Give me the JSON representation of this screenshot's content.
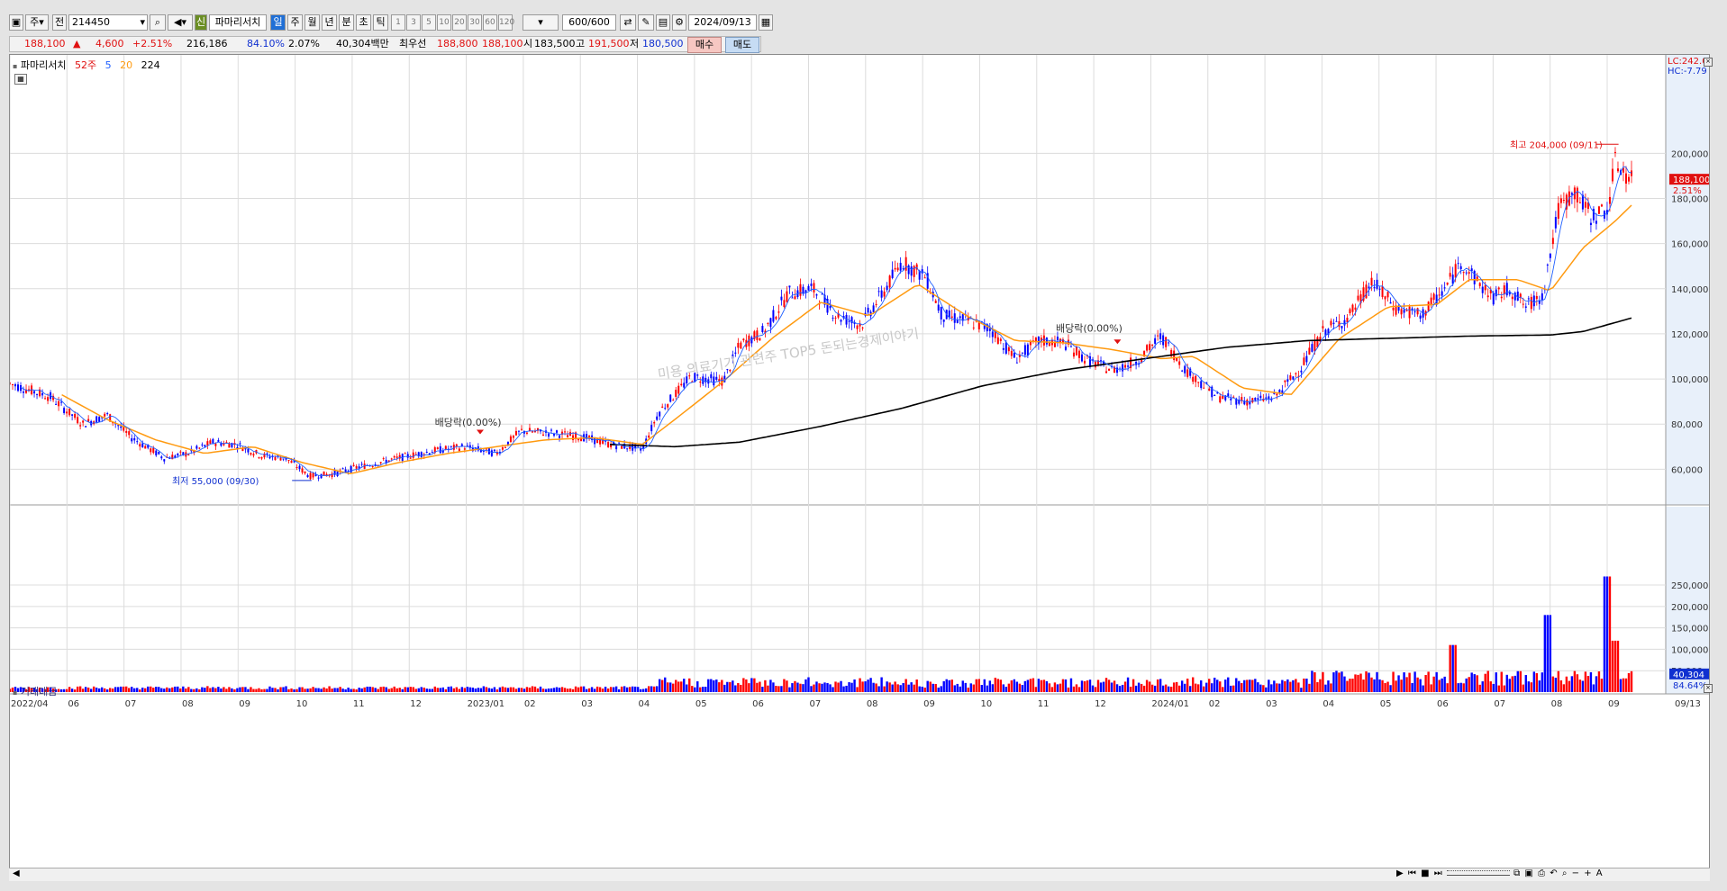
{
  "toolbar": {
    "market_select": "주",
    "scope_label": "전",
    "code": "214450",
    "new_badge": "신",
    "stock_name": "파마리서치",
    "periods": [
      "일",
      "주",
      "월",
      "년",
      "분",
      "초",
      "틱"
    ],
    "active_period": "일",
    "intervals": [
      "1",
      "3",
      "5",
      "10",
      "20",
      "30",
      "60",
      "120"
    ],
    "count": "600",
    "count_total": "/600",
    "date": "2024/09/13"
  },
  "quote": {
    "price": "188,100",
    "arrow": "▲",
    "change": "4,600",
    "change_pct": "+2.51%",
    "volume": "216,186",
    "ratio1": "84.10%",
    "ratio2": "2.07%",
    "amount": "40,304백만",
    "best_label": "최우선",
    "ask": "188,800",
    "bid": "188,100",
    "open_label": "시",
    "open": "183,500",
    "high_label": "고",
    "high": "191,500",
    "low_label": "저",
    "low": "180,500",
    "buy_label": "매수",
    "sell_label": "매도"
  },
  "legend": {
    "name": "파마리서치",
    "ma_52": "52주",
    "ma_5": "5",
    "ma_20": "20",
    "ma_224": "224"
  },
  "volume_panel": {
    "title": "거래대금"
  },
  "annotations": {
    "high": "최고 204,000 (09/11)",
    "low": "최저 55,000 (09/30)",
    "ex_div1": "배당락(0.00%)",
    "ex_div2": "배당락(0.00%)",
    "watermark": "미용 의료기기 관련주 TOP5 돈되는경제이야기"
  },
  "right_axis": {
    "lc": "LC:242.00",
    "hc": "HC:-7.79",
    "price_tag": "188,100",
    "pct_tag": "2.51%",
    "vol_tag": "40,304",
    "vol_pct": "84.64%",
    "date_tag": "09/13"
  },
  "colors": {
    "up": "#ff0000",
    "down": "#0000ff",
    "ma5": "#2060ff",
    "ma20": "#ff9a10",
    "ma224": "#000000",
    "grid": "#dcdcdc"
  },
  "chart_data": {
    "type": "candlestick",
    "ylim": [
      45000,
      242000
    ],
    "price_ticks": [
      "200,000",
      "180,000",
      "160,000",
      "140,000",
      "120,000",
      "100,000",
      "80,000",
      "60,000"
    ],
    "price_tick_values": [
      200000,
      180000,
      160000,
      140000,
      120000,
      100000,
      80000,
      60000
    ],
    "volume_ticks": [
      "250,000",
      "200,000",
      "150,000",
      "100,000",
      "50,000"
    ],
    "volume_tick_values": [
      250000,
      200000,
      150000,
      100000,
      50000
    ],
    "volume_ylim": [
      0,
      290000
    ],
    "x_labels": [
      "2022/04",
      "06",
      "07",
      "08",
      "09",
      "10",
      "11",
      "12",
      "2023/01",
      "02",
      "03",
      "04",
      "05",
      "06",
      "07",
      "08",
      "09",
      "10",
      "11",
      "12",
      "2024/01",
      "02",
      "03",
      "04",
      "05",
      "06",
      "07",
      "08",
      "09"
    ],
    "price_path": [
      [
        0,
        98000
      ],
      [
        0.025,
        92000
      ],
      [
        0.045,
        80000
      ],
      [
        0.06,
        84000
      ],
      [
        0.075,
        74000
      ],
      [
        0.095,
        65000
      ],
      [
        0.11,
        67000
      ],
      [
        0.125,
        72000
      ],
      [
        0.14,
        71000
      ],
      [
        0.155,
        66000
      ],
      [
        0.17,
        65000
      ],
      [
        0.185,
        57000
      ],
      [
        0.2,
        58000
      ],
      [
        0.215,
        61000
      ],
      [
        0.24,
        65000
      ],
      [
        0.26,
        68000
      ],
      [
        0.28,
        70000
      ],
      [
        0.3,
        67000
      ],
      [
        0.315,
        77000
      ],
      [
        0.335,
        76000
      ],
      [
        0.355,
        74000
      ],
      [
        0.37,
        71000
      ],
      [
        0.39,
        69000
      ],
      [
        0.4,
        85000
      ],
      [
        0.42,
        101000
      ],
      [
        0.44,
        99000
      ],
      [
        0.45,
        115000
      ],
      [
        0.465,
        121000
      ],
      [
        0.48,
        138000
      ],
      [
        0.495,
        140000
      ],
      [
        0.51,
        128000
      ],
      [
        0.525,
        124000
      ],
      [
        0.54,
        140000
      ],
      [
        0.55,
        152000
      ],
      [
        0.565,
        145000
      ],
      [
        0.575,
        128000
      ],
      [
        0.59,
        126000
      ],
      [
        0.605,
        122000
      ],
      [
        0.62,
        109000
      ],
      [
        0.635,
        117000
      ],
      [
        0.65,
        116000
      ],
      [
        0.665,
        108000
      ],
      [
        0.68,
        104000
      ],
      [
        0.695,
        108000
      ],
      [
        0.71,
        119000
      ],
      [
        0.725,
        104000
      ],
      [
        0.745,
        92000
      ],
      [
        0.765,
        90000
      ],
      [
        0.78,
        92000
      ],
      [
        0.795,
        104000
      ],
      [
        0.81,
        121000
      ],
      [
        0.825,
        127000
      ],
      [
        0.84,
        143000
      ],
      [
        0.855,
        131000
      ],
      [
        0.87,
        128000
      ],
      [
        0.885,
        140000
      ],
      [
        0.895,
        152000
      ],
      [
        0.905,
        143000
      ],
      [
        0.915,
        136000
      ],
      [
        0.925,
        140000
      ],
      [
        0.935,
        132000
      ],
      [
        0.945,
        137000
      ],
      [
        0.955,
        175000
      ],
      [
        0.965,
        183000
      ],
      [
        0.975,
        172000
      ],
      [
        0.985,
        175000
      ],
      [
        0.99,
        196000
      ],
      [
        1.0,
        188100
      ]
    ],
    "ma20_path": [
      [
        0.032,
        93000
      ],
      [
        0.06,
        82000
      ],
      [
        0.09,
        73000
      ],
      [
        0.12,
        67000
      ],
      [
        0.15,
        70000
      ],
      [
        0.18,
        63000
      ],
      [
        0.21,
        58000
      ],
      [
        0.24,
        63000
      ],
      [
        0.27,
        67000
      ],
      [
        0.3,
        70000
      ],
      [
        0.33,
        73000
      ],
      [
        0.36,
        74000
      ],
      [
        0.39,
        71000
      ],
      [
        0.41,
        82000
      ],
      [
        0.44,
        99000
      ],
      [
        0.47,
        118000
      ],
      [
        0.5,
        134000
      ],
      [
        0.53,
        128000
      ],
      [
        0.56,
        142000
      ],
      [
        0.59,
        128000
      ],
      [
        0.62,
        117000
      ],
      [
        0.65,
        116000
      ],
      [
        0.68,
        113000
      ],
      [
        0.71,
        109000
      ],
      [
        0.73,
        110000
      ],
      [
        0.76,
        96000
      ],
      [
        0.79,
        93000
      ],
      [
        0.82,
        118000
      ],
      [
        0.85,
        132000
      ],
      [
        0.88,
        133000
      ],
      [
        0.9,
        144000
      ],
      [
        0.93,
        144000
      ],
      [
        0.95,
        139000
      ],
      [
        0.97,
        158000
      ],
      [
        0.99,
        170000
      ],
      [
        1.0,
        177000
      ]
    ],
    "ma224_path": [
      [
        0.37,
        71000
      ],
      [
        0.41,
        70000
      ],
      [
        0.45,
        72000
      ],
      [
        0.5,
        79000
      ],
      [
        0.55,
        87000
      ],
      [
        0.6,
        97000
      ],
      [
        0.65,
        104000
      ],
      [
        0.7,
        109000
      ],
      [
        0.75,
        114000
      ],
      [
        0.8,
        117000
      ],
      [
        0.85,
        118000
      ],
      [
        0.9,
        119000
      ],
      [
        0.95,
        119500
      ],
      [
        0.97,
        121000
      ],
      [
        1.0,
        127000
      ]
    ]
  }
}
